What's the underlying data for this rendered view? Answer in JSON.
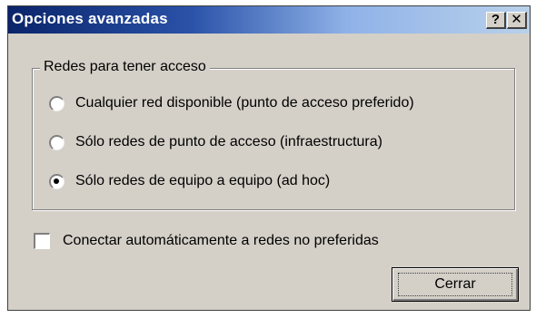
{
  "window": {
    "title": "Opciones avanzadas",
    "help_label": "?",
    "close_label": "✕"
  },
  "group": {
    "legend": "Redes para tener acceso",
    "options": [
      {
        "label": "Cualquier red disponible (punto de acceso preferido)",
        "selected": false
      },
      {
        "label": "Sólo redes de punto de acceso (infraestructura)",
        "selected": false
      },
      {
        "label": "Sólo redes de equipo a equipo (ad hoc)",
        "selected": true
      }
    ]
  },
  "checkbox": {
    "label": "Conectar automáticamente a redes no preferidas",
    "checked": false
  },
  "button": {
    "close_label": "Cerrar"
  },
  "colors": {
    "title_bar_start": "#0a246a",
    "title_bar_end": "#b9d1ea",
    "face": "#d4d0c8"
  },
  "icons": {
    "help": "question-mark-icon",
    "close": "close-x-icon"
  }
}
